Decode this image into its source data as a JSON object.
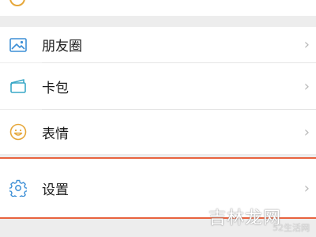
{
  "colors": {
    "icon_moments": "#3d8fd6",
    "icon_card": "#3aa8c7",
    "icon_sticker": "#e6a73a",
    "icon_settings": "#3d8fd6",
    "highlight": "#e8633f"
  },
  "menu": {
    "items": [
      {
        "label": "朋友圈",
        "icon": "image-icon",
        "chevron": "›"
      },
      {
        "label": "卡包",
        "icon": "card-wallet-icon",
        "chevron": "›"
      },
      {
        "label": "表情",
        "icon": "smiley-icon",
        "chevron": "›"
      },
      {
        "label": "设置",
        "icon": "gear-icon",
        "chevron": "›"
      }
    ]
  },
  "watermark": {
    "main": "吉林龙网",
    "sub": "52生活网"
  }
}
